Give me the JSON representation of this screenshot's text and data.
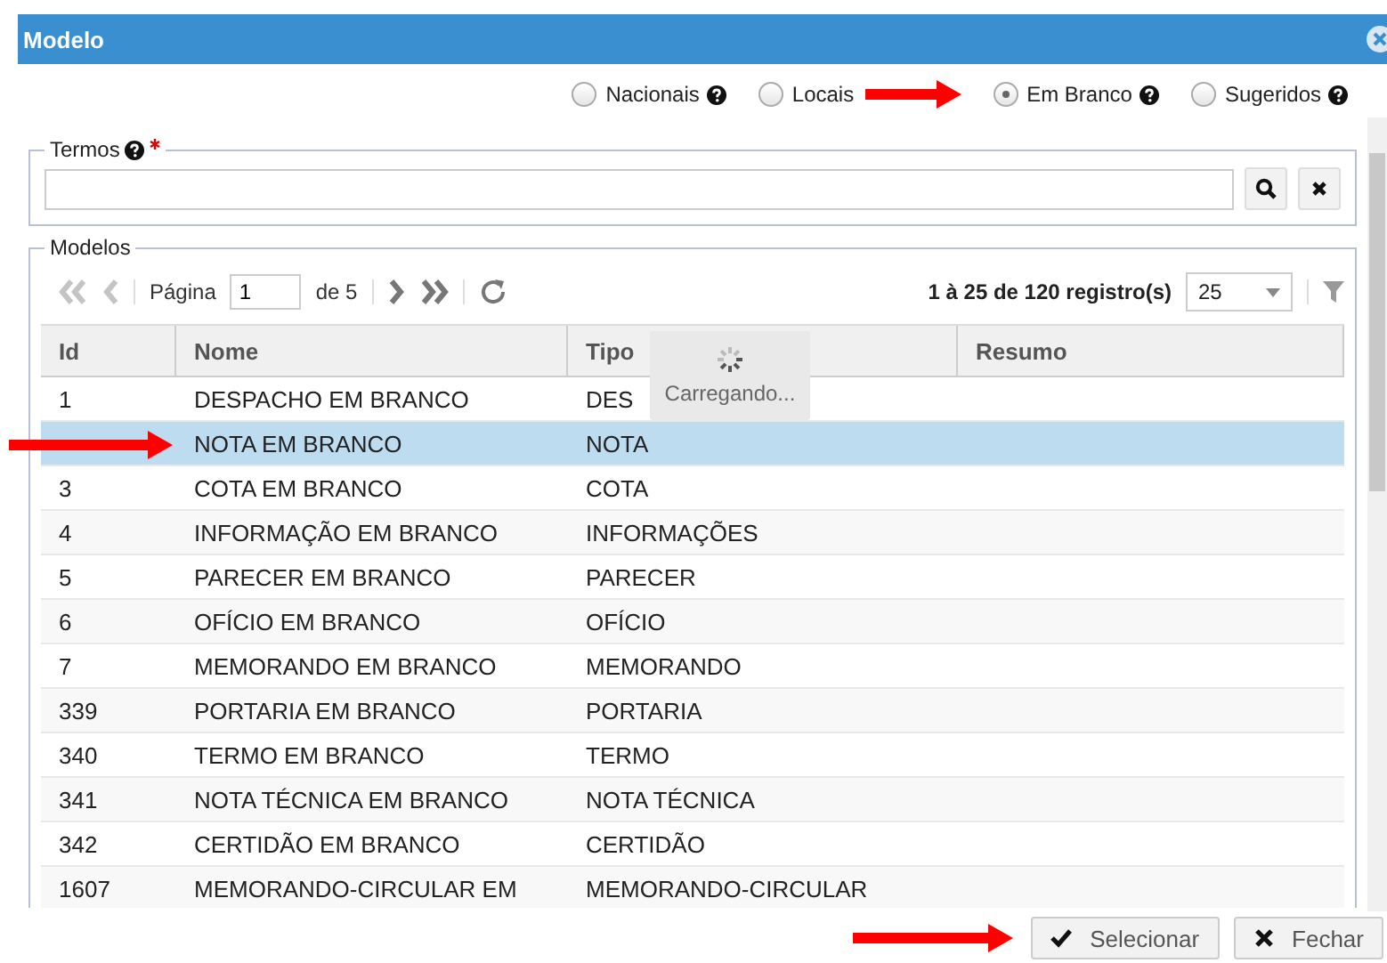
{
  "window": {
    "title": "Modelo"
  },
  "filters": [
    {
      "label": "Nacionais",
      "selected": false,
      "help": true
    },
    {
      "label": "Locais",
      "selected": false,
      "help": false
    },
    {
      "label": "Em Branco",
      "selected": true,
      "help": true
    },
    {
      "label": "Sugeridos",
      "selected": false,
      "help": true
    }
  ],
  "terms": {
    "legend": "Termos",
    "required": true
  },
  "models": {
    "legend": "Modelos",
    "page_label": "Página",
    "page": "1",
    "page_of": "de 5",
    "summary": "1 à 25 de 120 registro(s)",
    "page_size": "25",
    "loading": "Carregando..."
  },
  "columns": [
    "Id",
    "Nome",
    "Tipo",
    "Resumo"
  ],
  "rows": [
    {
      "id": "1",
      "name": "DESPACHO EM BRANCO",
      "type": "DES",
      "selected": false
    },
    {
      "name": "NOTA EM BRANCO",
      "type": "NOTA",
      "selected": true
    },
    {
      "id": "3",
      "name": "COTA EM BRANCO",
      "type": "COTA",
      "selected": false
    },
    {
      "id": "4",
      "name": "INFORMAÇÃO EM BRANCO",
      "type": "INFORMAÇÕES",
      "selected": false
    },
    {
      "id": "5",
      "name": "PARECER EM BRANCO",
      "type": "PARECER",
      "selected": false
    },
    {
      "id": "6",
      "name": "OFÍCIO EM BRANCO",
      "type": "OFÍCIO",
      "selected": false
    },
    {
      "id": "7",
      "name": "MEMORANDO EM BRANCO",
      "type": "MEMORANDO",
      "selected": false
    },
    {
      "id": "339",
      "name": "PORTARIA EM BRANCO",
      "type": "PORTARIA",
      "selected": false
    },
    {
      "id": "340",
      "name": "TERMO EM BRANCO",
      "type": "TERMO",
      "selected": false
    },
    {
      "id": "341",
      "name": "NOTA TÉCNICA EM BRANCO",
      "type": "NOTA TÉCNICA",
      "selected": false
    },
    {
      "id": "342",
      "name": "CERTIDÃO EM BRANCO",
      "type": "CERTIDÃO",
      "selected": false
    },
    {
      "id": "1607",
      "name": "MEMORANDO-CIRCULAR EM",
      "type": "MEMORANDO-CIRCULAR",
      "selected": false
    }
  ],
  "buttons": [
    {
      "label": "Selecionar",
      "kind": "confirm"
    },
    {
      "label": "Fechar",
      "kind": "cancel"
    }
  ]
}
